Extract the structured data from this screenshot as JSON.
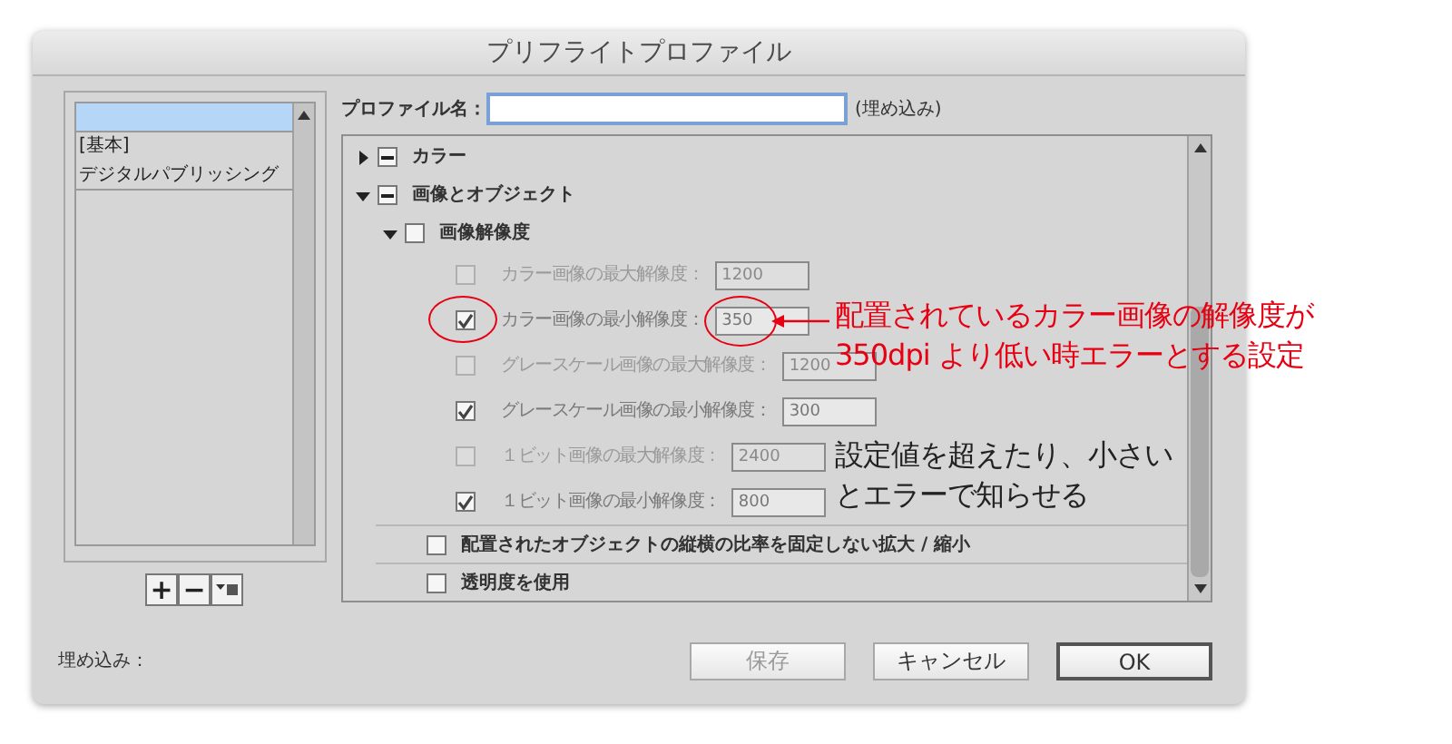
{
  "window": {
    "title": "プリフライトプロファイル"
  },
  "profile_list": {
    "new_row_selected": true,
    "items": [
      {
        "label": "[基本]",
        "selected": false
      },
      {
        "label": "デジタルパブリッシング",
        "selected": false
      }
    ]
  },
  "list_buttons": [
    "+",
    "−"
  ],
  "profile_name": {
    "label": "プロファイル名：",
    "note": "(埋め込み)"
  },
  "tree": [
    {
      "label": "カラー",
      "checked": true,
      "partial": true,
      "expanded": false
    },
    {
      "label": "画像とオブジェクト",
      "checked": true,
      "partial": true,
      "expanded": true,
      "children": [
        {
          "label": "画像解像度",
          "checked": false,
          "expanded": true,
          "children": [
            {
              "label": "カラー画像の最大解像度：",
              "checked": false,
              "value": "1200",
              "circled": false
            },
            {
              "label": "カラー画像の最小解像度：",
              "checked": true,
              "value": "350",
              "circled": true
            },
            {
              "label": "グレースケール画像の最大解像度：",
              "checked": false,
              "value": "1200",
              "circled": false
            },
            {
              "label": "グレースケール画像の最小解像度：",
              "checked": true,
              "value": "300",
              "circled": false
            },
            {
              "label": "１ビット画像の最大解像度：",
              "checked": false,
              "value": "2400",
              "circled": false
            },
            {
              "label": "１ビット画像の最小解像度：",
              "checked": true,
              "value": "800",
              "circled": false
            }
          ]
        },
        {
          "label": "配置されたオブジェクトの縦横の比率を固定しない拡大 / 縮小",
          "checked": false
        },
        {
          "label": "透明度を使用",
          "checked": false
        }
      ]
    }
  ],
  "embed_label": "埋め込み：",
  "buttons": [
    {
      "label": "保存",
      "disabled": true,
      "default": false
    },
    {
      "label": "キャンセル",
      "disabled": false,
      "default": false
    },
    {
      "label": "OK",
      "disabled": false,
      "default": true
    }
  ],
  "annotations": [
    {
      "kind": "callout",
      "color": "#e60012",
      "lines": [
        "配置されているカラー画像の解像度が",
        "350dpi より低い時エラーとする設定"
      ]
    },
    {
      "kind": "note",
      "color": "#222222",
      "lines": [
        "設定値を超えたり、小さい",
        "とエラーで知らせる"
      ]
    }
  ]
}
